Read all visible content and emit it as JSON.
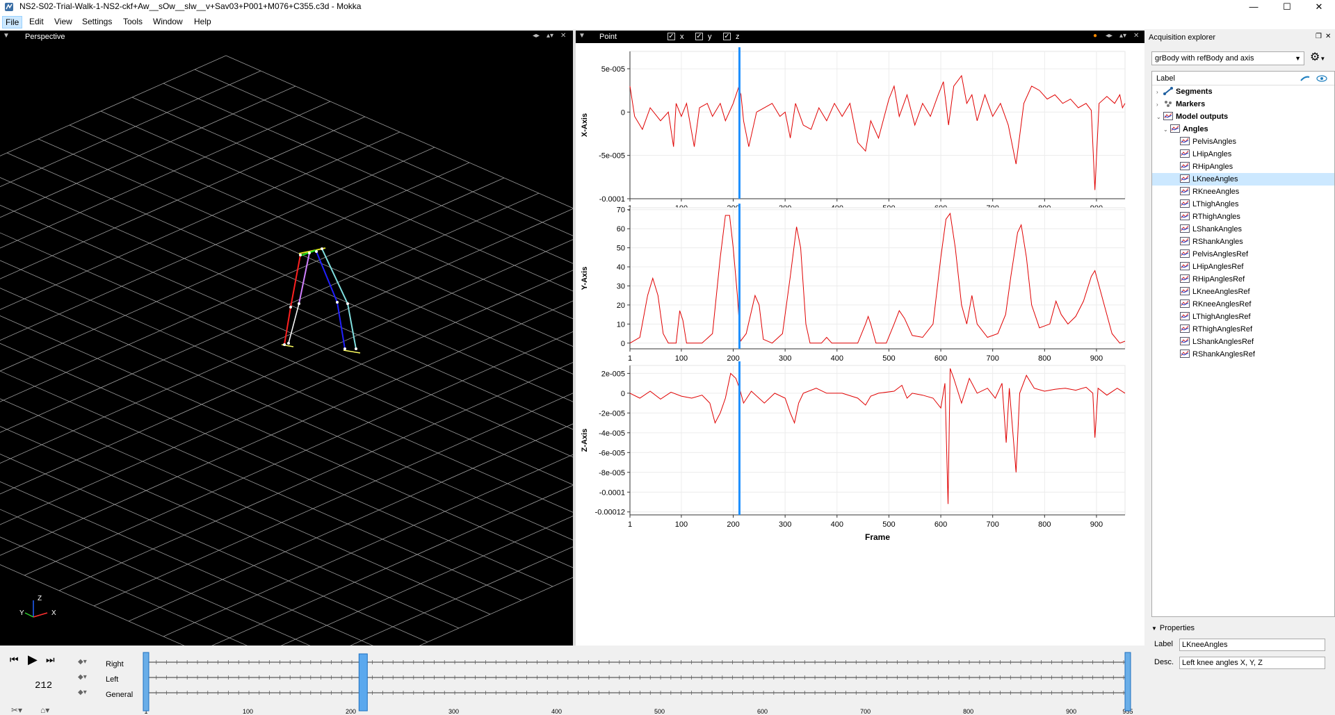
{
  "window": {
    "title": "NS2-S02-Trial-Walk-1-NS2-ckf+Aw__sOw__slw__v+Sav03+P001+M076+C355.c3d - Mokka",
    "controls": [
      "—",
      "☐",
      "✕"
    ]
  },
  "menu": [
    "File",
    "Edit",
    "View",
    "Settings",
    "Tools",
    "Window",
    "Help"
  ],
  "view3d": {
    "dock_label": "Perspective",
    "axes": {
      "x": "X",
      "y": "Y",
      "z": "Z"
    }
  },
  "chart_panel": {
    "dock_label": "Point",
    "toggles": [
      {
        "label": "x",
        "checked": true
      },
      {
        "label": "y",
        "checked": true
      },
      {
        "label": "z",
        "checked": true
      }
    ]
  },
  "chart_data": [
    {
      "type": "line",
      "ylabel": "X-Axis",
      "xlabel": "",
      "xlim": [
        1,
        955
      ],
      "ylim": [
        -0.0001,
        7e-05
      ],
      "xticks": [
        "1",
        "100",
        "200",
        "300",
        "400",
        "500",
        "600",
        "700",
        "800",
        "900"
      ],
      "yticks": [
        {
          "v": 5e-05,
          "label": "5e-005"
        },
        {
          "v": 0,
          "label": "0"
        },
        {
          "v": -5e-05,
          "label": "-5e-005"
        },
        {
          "v": -0.0001,
          "label": "-0.0001"
        }
      ],
      "cursor_frame": 212,
      "series": [
        {
          "color": "#e00000",
          "values": [
            [
              1,
              3e-05
            ],
            [
              10,
              -5e-06
            ],
            [
              25,
              -2e-05
            ],
            [
              40,
              5e-06
            ],
            [
              60,
              -1e-05
            ],
            [
              75,
              0.0
            ],
            [
              85,
              -4e-05
            ],
            [
              90,
              1e-05
            ],
            [
              100,
              -5e-06
            ],
            [
              110,
              1e-05
            ],
            [
              125,
              -4e-05
            ],
            [
              135,
              5e-06
            ],
            [
              150,
              1e-05
            ],
            [
              160,
              -5e-06
            ],
            [
              175,
              1e-05
            ],
            [
              185,
              -1e-05
            ],
            [
              200,
              1e-05
            ],
            [
              210,
              2.8e-05
            ],
            [
              215,
              2e-05
            ],
            [
              220,
              -1e-05
            ],
            [
              230,
              -4e-05
            ],
            [
              245,
              0.0
            ],
            [
              260,
              5e-06
            ],
            [
              275,
              1e-05
            ],
            [
              290,
              -5e-06
            ],
            [
              300,
              0.0
            ],
            [
              310,
              -3e-05
            ],
            [
              320,
              1e-05
            ],
            [
              335,
              -1.5e-05
            ],
            [
              350,
              -2e-05
            ],
            [
              365,
              5e-06
            ],
            [
              380,
              -1e-05
            ],
            [
              395,
              1e-05
            ],
            [
              410,
              -5e-06
            ],
            [
              425,
              1e-05
            ],
            [
              440,
              -3.5e-05
            ],
            [
              455,
              -4.5e-05
            ],
            [
              465,
              -1e-05
            ],
            [
              480,
              -3e-05
            ],
            [
              500,
              1.5e-05
            ],
            [
              510,
              3e-05
            ],
            [
              520,
              -5e-06
            ],
            [
              535,
              2e-05
            ],
            [
              550,
              -1.5e-05
            ],
            [
              565,
              1e-05
            ],
            [
              580,
              -5e-06
            ],
            [
              595,
              2e-05
            ],
            [
              605,
              3.5e-05
            ],
            [
              615,
              -1.5e-05
            ],
            [
              625,
              3e-05
            ],
            [
              640,
              4.2e-05
            ],
            [
              650,
              1e-05
            ],
            [
              660,
              2e-05
            ],
            [
              670,
              -1e-05
            ],
            [
              685,
              2e-05
            ],
            [
              700,
              -5e-06
            ],
            [
              715,
              1e-05
            ],
            [
              730,
              -1.5e-05
            ],
            [
              745,
              -6e-05
            ],
            [
              760,
              1e-05
            ],
            [
              775,
              3e-05
            ],
            [
              790,
              2.5e-05
            ],
            [
              805,
              1.5e-05
            ],
            [
              820,
              2e-05
            ],
            [
              835,
              1e-05
            ],
            [
              850,
              1.5e-05
            ],
            [
              865,
              5e-06
            ],
            [
              880,
              1e-05
            ],
            [
              890,
              2e-06
            ],
            [
              897,
              -9e-05
            ],
            [
              905,
              1e-05
            ],
            [
              920,
              1.8e-05
            ],
            [
              935,
              1e-05
            ],
            [
              945,
              2e-05
            ],
            [
              950,
              5e-06
            ],
            [
              955,
              1e-05
            ]
          ]
        }
      ]
    },
    {
      "type": "line",
      "ylabel": "Y-Axis",
      "xlabel": "",
      "xlim": [
        1,
        955
      ],
      "ylim": [
        -3,
        71
      ],
      "xticks": [
        "1",
        "100",
        "200",
        "300",
        "400",
        "500",
        "600",
        "700",
        "800",
        "900"
      ],
      "yticks": [
        {
          "v": 70,
          "label": "70"
        },
        {
          "v": 60,
          "label": "60"
        },
        {
          "v": 50,
          "label": "50"
        },
        {
          "v": 40,
          "label": "40"
        },
        {
          "v": 30,
          "label": "30"
        },
        {
          "v": 20,
          "label": "20"
        },
        {
          "v": 10,
          "label": "10"
        },
        {
          "v": 0,
          "label": "0"
        }
      ],
      "cursor_frame": 212,
      "series": [
        {
          "color": "#e00000",
          "values": [
            [
              1,
              0
            ],
            [
              20,
              3
            ],
            [
              35,
              25
            ],
            [
              45,
              34
            ],
            [
              55,
              25
            ],
            [
              65,
              5
            ],
            [
              75,
              0
            ],
            [
              90,
              0
            ],
            [
              97,
              17
            ],
            [
              103,
              12
            ],
            [
              110,
              0
            ],
            [
              140,
              0
            ],
            [
              160,
              5
            ],
            [
              175,
              45
            ],
            [
              185,
              67
            ],
            [
              193,
              67
            ],
            [
              200,
              50
            ],
            [
              208,
              25
            ],
            [
              214,
              1
            ],
            [
              225,
              5
            ],
            [
              242,
              25
            ],
            [
              250,
              20
            ],
            [
              258,
              2
            ],
            [
              275,
              0
            ],
            [
              295,
              5
            ],
            [
              310,
              35
            ],
            [
              322,
              61
            ],
            [
              330,
              50
            ],
            [
              340,
              10
            ],
            [
              348,
              0
            ],
            [
              370,
              0
            ],
            [
              380,
              3
            ],
            [
              390,
              0
            ],
            [
              440,
              0
            ],
            [
              455,
              10
            ],
            [
              460,
              14
            ],
            [
              465,
              10
            ],
            [
              475,
              0
            ],
            [
              495,
              0
            ],
            [
              510,
              10
            ],
            [
              520,
              17
            ],
            [
              530,
              13
            ],
            [
              545,
              4
            ],
            [
              565,
              3
            ],
            [
              585,
              10
            ],
            [
              600,
              45
            ],
            [
              610,
              65
            ],
            [
              618,
              68
            ],
            [
              628,
              50
            ],
            [
              640,
              20
            ],
            [
              650,
              10
            ],
            [
              660,
              25
            ],
            [
              670,
              10
            ],
            [
              690,
              3
            ],
            [
              710,
              5
            ],
            [
              725,
              15
            ],
            [
              735,
              35
            ],
            [
              748,
              58
            ],
            [
              755,
              62
            ],
            [
              765,
              45
            ],
            [
              775,
              20
            ],
            [
              790,
              8
            ],
            [
              810,
              10
            ],
            [
              822,
              22
            ],
            [
              832,
              15
            ],
            [
              845,
              10
            ],
            [
              860,
              14
            ],
            [
              875,
              22
            ],
            [
              890,
              35
            ],
            [
              897,
              38
            ],
            [
              905,
              30
            ],
            [
              915,
              20
            ],
            [
              930,
              5
            ],
            [
              945,
              0
            ],
            [
              955,
              1
            ]
          ]
        }
      ]
    },
    {
      "type": "line",
      "ylabel": "Z-Axis",
      "xlabel": "Frame",
      "xlim": [
        1,
        955
      ],
      "ylim": [
        -0.000123,
        2.8e-05
      ],
      "xticks": [
        "1",
        "100",
        "200",
        "300",
        "400",
        "500",
        "600",
        "700",
        "800",
        "900"
      ],
      "yticks": [
        {
          "v": 2e-05,
          "label": "2e-005"
        },
        {
          "v": 0,
          "label": "0"
        },
        {
          "v": -2e-05,
          "label": "-2e-005"
        },
        {
          "v": -4e-05,
          "label": "-4e-005"
        },
        {
          "v": -6e-05,
          "label": "-6e-005"
        },
        {
          "v": -8e-05,
          "label": "-8e-005"
        },
        {
          "v": -0.0001,
          "label": "-0.0001"
        },
        {
          "v": -0.00012,
          "label": "-0.00012"
        }
      ],
      "cursor_frame": 212,
      "series": [
        {
          "color": "#e00000",
          "values": [
            [
              1,
              0
            ],
            [
              20,
              -5e-06
            ],
            [
              40,
              2e-06
            ],
            [
              60,
              -6e-06
            ],
            [
              80,
              1e-06
            ],
            [
              100,
              -3e-06
            ],
            [
              120,
              -5e-06
            ],
            [
              140,
              -2e-06
            ],
            [
              155,
              -1e-05
            ],
            [
              165,
              -3e-05
            ],
            [
              175,
              -2e-05
            ],
            [
              185,
              -5e-06
            ],
            [
              195,
              2e-05
            ],
            [
              205,
              1.5e-05
            ],
            [
              212,
              5e-06
            ],
            [
              220,
              -1e-05
            ],
            [
              235,
              2e-06
            ],
            [
              260,
              -1e-05
            ],
            [
              280,
              0.0
            ],
            [
              300,
              -5e-06
            ],
            [
              310,
              -2e-05
            ],
            [
              318,
              -3e-05
            ],
            [
              326,
              -1e-05
            ],
            [
              335,
              0.0
            ],
            [
              360,
              5e-06
            ],
            [
              380,
              0.0
            ],
            [
              410,
              0.0
            ],
            [
              440,
              -5e-06
            ],
            [
              455,
              -1.2e-05
            ],
            [
              465,
              -3e-06
            ],
            [
              480,
              0.0
            ],
            [
              510,
              2e-06
            ],
            [
              525,
              8e-06
            ],
            [
              535,
              -5e-06
            ],
            [
              545,
              0.0
            ],
            [
              565,
              -2e-06
            ],
            [
              585,
              -5e-06
            ],
            [
              600,
              -1.5e-05
            ],
            [
              608,
              1e-05
            ],
            [
              614,
              -0.000112
            ],
            [
              618,
              2.5e-05
            ],
            [
              625,
              1.5e-05
            ],
            [
              640,
              -1e-05
            ],
            [
              655,
              1.5e-05
            ],
            [
              670,
              0.0
            ],
            [
              690,
              5e-06
            ],
            [
              705,
              -5e-06
            ],
            [
              718,
              1e-05
            ],
            [
              726,
              -5e-05
            ],
            [
              732,
              5e-06
            ],
            [
              745,
              -8e-05
            ],
            [
              752,
              0.0
            ],
            [
              765,
              1.8e-05
            ],
            [
              780,
              5e-06
            ],
            [
              800,
              2e-06
            ],
            [
              820,
              4e-06
            ],
            [
              840,
              5e-06
            ],
            [
              860,
              3e-06
            ],
            [
              880,
              6e-06
            ],
            [
              893,
              0.0
            ],
            [
              897,
              -4.5e-05
            ],
            [
              903,
              5e-06
            ],
            [
              920,
              -2e-06
            ],
            [
              940,
              5e-06
            ],
            [
              955,
              0.0
            ]
          ]
        }
      ]
    }
  ],
  "explorer": {
    "title": "Acquisition explorer",
    "combo_value": "grBody with refBody and axis",
    "tree_header": "Label",
    "groups": {
      "segments": "Segments",
      "markers": "Markers",
      "model_outputs": "Model outputs",
      "angles": "Angles"
    },
    "angle_items": [
      "PelvisAngles",
      "LHipAngles",
      "RHipAngles",
      "LKneeAngles",
      "RKneeAngles",
      "LThighAngles",
      "RThighAngles",
      "LShankAngles",
      "RShankAngles",
      "PelvisAnglesRef",
      "LHipAnglesRef",
      "RHipAnglesRef",
      "LKneeAnglesRef",
      "RKneeAnglesRef",
      "LThighAnglesRef",
      "RThighAnglesRef",
      "LShankAnglesRef",
      "RShankAnglesRef"
    ],
    "selected_item": "LKneeAngles",
    "properties": {
      "title": "Properties",
      "label_caption": "Label",
      "label_value": "LKneeAngles",
      "desc_caption": "Desc.",
      "desc_value": "Left knee angles X, Y, Z"
    }
  },
  "timeline": {
    "current_frame": "212",
    "tracks": [
      "Right",
      "Left",
      "General"
    ],
    "ticks": [
      "1",
      "100",
      "200",
      "300",
      "400",
      "500",
      "600",
      "700",
      "800",
      "900",
      "955"
    ]
  }
}
